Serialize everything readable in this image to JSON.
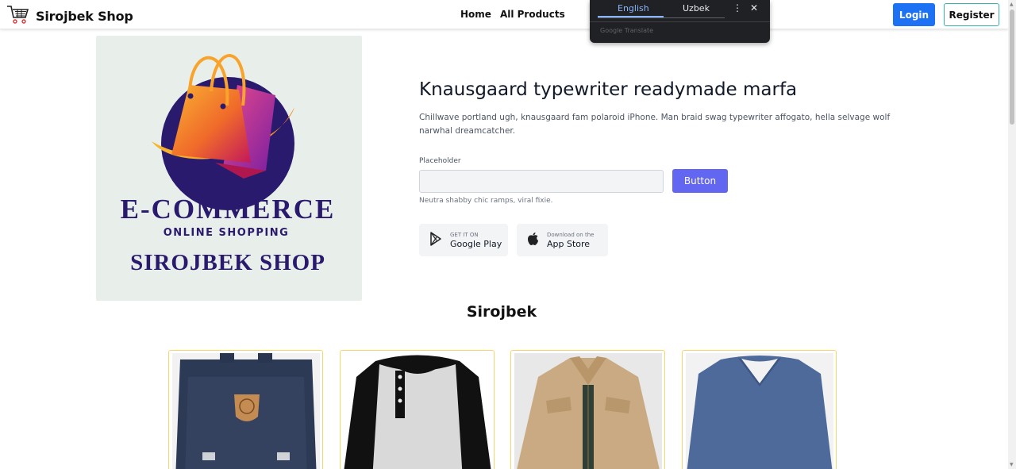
{
  "navbar": {
    "brand": "Sirojbek Shop",
    "links": [
      "Home",
      "All Products"
    ],
    "login_label": "Login",
    "register_label": "Register"
  },
  "translate_popup": {
    "tabs": [
      "English",
      "Uzbek"
    ],
    "selected": "English",
    "menu_icon": "more-vert-icon",
    "close_icon": "close-icon",
    "brand": "Google Translate"
  },
  "hero": {
    "logo": {
      "line1": "E-COMMERCE",
      "line2": "ONLINE SHOPPING",
      "line3": "SIROJBEK SHOP"
    },
    "title": "Knausgaard typewriter readymade marfa",
    "description": "Chillwave portland ugh, knausgaard fam polaroid iPhone. Man braid swag typewriter affogato, hella selvage wolf narwhal dreamcatcher.",
    "field_label": "Placeholder",
    "field_value": "",
    "button_label": "Button",
    "help_text": "Neutra shabby chic ramps, viral fixie.",
    "stores": [
      {
        "small": "GET IT ON",
        "big": "Google Play",
        "icon": "google-play-icon"
      },
      {
        "small": "Download on the",
        "big": "App Store",
        "icon": "apple-icon"
      }
    ]
  },
  "section_title": "Sirojbek",
  "products": [
    {
      "image": "backpack-image"
    },
    {
      "image": "henley-shirt-image"
    },
    {
      "image": "jacket-image"
    },
    {
      "image": "sweater-image"
    }
  ],
  "colors": {
    "login": "#1d72f3",
    "register_border": "#38b2ac",
    "primary_button": "#6366f1",
    "card_border": "#f6d66b",
    "logo_text": "#2a1a6e"
  }
}
